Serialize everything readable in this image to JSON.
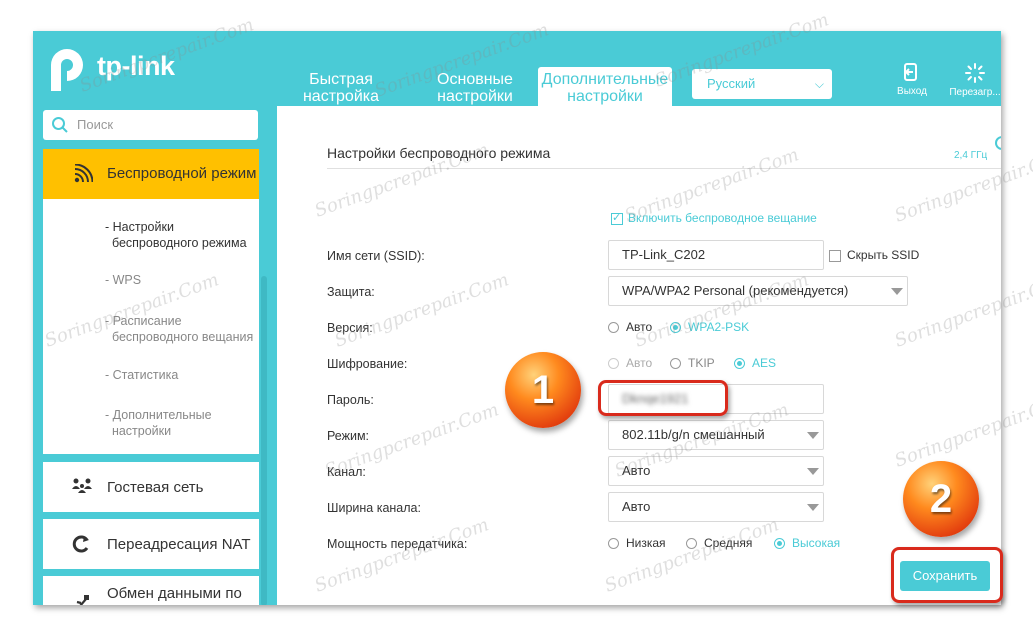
{
  "brand": {
    "name": "tp-link"
  },
  "nav": {
    "tabs": [
      {
        "label": "Быстрая\nнастройка"
      },
      {
        "label": "Основные\nнастройки"
      },
      {
        "label": "Дополнительные\nнастройки"
      }
    ],
    "language": "Русский",
    "logout": "Выход",
    "reboot": "Перезагр..."
  },
  "sidebar": {
    "search_placeholder": "Поиск",
    "wireless": {
      "label": "Беспроводной режим",
      "items": [
        {
          "label": "- Настройки\n  беспроводного режима"
        },
        {
          "label": "- WPS"
        },
        {
          "label": "- Расписание\n  беспроводного вещания"
        },
        {
          "label": "- Статистика"
        },
        {
          "label": "- Дополнительные\n  настройки"
        }
      ]
    },
    "sections": [
      {
        "label": "Гостевая сеть",
        "icon": "guests-icon"
      },
      {
        "label": "Переадресация NAT",
        "icon": "nat-icon"
      },
      {
        "label": "Обмен данными по",
        "icon": "usb-icon"
      }
    ]
  },
  "main": {
    "title": "Настройки беспроводного режима",
    "band": "2,4 ГГц",
    "enable_broadcast": "Включить беспроводное вещание",
    "ssid": {
      "label": "Имя сети (SSID):",
      "value": "TP-Link_C202",
      "hide_label": "Скрыть SSID"
    },
    "security": {
      "label": "Защита:",
      "value": "WPA/WPA2 Personal (рекомендуется)"
    },
    "version": {
      "label": "Версия:",
      "options": [
        "Авто",
        "WPA2-PSK"
      ],
      "selected": "WPA2-PSK"
    },
    "encryption": {
      "label": "Шифрование:",
      "options": [
        "Авто",
        "TKIP",
        "AES"
      ],
      "selected": "AES"
    },
    "password": {
      "label": "Пароль:",
      "value": "Dknqe1921"
    },
    "mode": {
      "label": "Режим:",
      "value": "802.11b/g/n смешанный"
    },
    "channel": {
      "label": "Канал:",
      "value": "Авто"
    },
    "width": {
      "label": "Ширина канала:",
      "value": "Авто"
    },
    "power": {
      "label": "Мощность передатчика:",
      "options": [
        "Низкая",
        "Средняя",
        "Высокая"
      ],
      "selected": "Высокая"
    },
    "save": "Сохранить"
  },
  "annotations": {
    "badge1": "1",
    "badge2": "2"
  },
  "watermark": "Soringpcrepair.Com",
  "colors": {
    "accent": "#4acbd6",
    "active_menu": "#ffc000",
    "highlight": "#d92a1c"
  }
}
